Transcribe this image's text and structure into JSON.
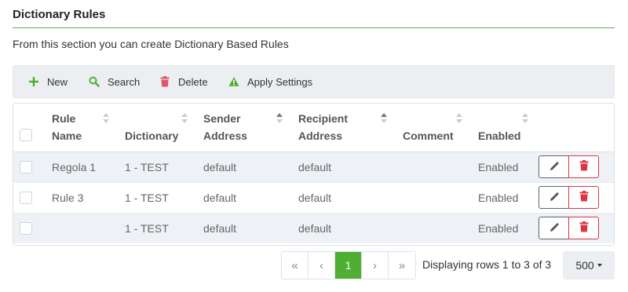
{
  "header": {
    "title": "Dictionary Rules",
    "description": "From this section you can create Dictionary Based Rules"
  },
  "toolbar": {
    "new_label": "New",
    "search_label": "Search",
    "delete_label": "Delete",
    "apply_label": "Apply Settings",
    "new_icon": "plus-icon",
    "search_icon": "search-icon",
    "delete_icon": "trash-icon",
    "apply_icon": "warning-icon",
    "new_color": "#4fae34",
    "search_color": "#4fae34",
    "delete_color": "#e0556a",
    "apply_color": "#4fae34"
  },
  "table": {
    "columns": {
      "rule_name_line1": "Rule",
      "rule_name_line2": "Name",
      "dictionary": "Dictionary",
      "sender_line1": "Sender",
      "sender_line2": "Address",
      "recipient_line1": "Recipient",
      "recipient_line2": "Address",
      "comment": "Comment",
      "enabled": "Enabled"
    },
    "sorted_column": "recipient",
    "rows": [
      {
        "rule_name": "Regola 1",
        "dictionary": "1 - TEST",
        "sender": "default",
        "recipient": "default",
        "comment": "",
        "enabled": "Enabled"
      },
      {
        "rule_name": "Rule 3",
        "dictionary": "1 - TEST",
        "sender": "default",
        "recipient": "default",
        "comment": "",
        "enabled": "Enabled"
      },
      {
        "rule_name": "",
        "dictionary": "1 - TEST",
        "sender": "default",
        "recipient": "default",
        "comment": "",
        "enabled": "Enabled"
      }
    ],
    "row_actions": {
      "edit_icon": "pencil-icon",
      "delete_icon": "trash-icon"
    }
  },
  "pagination": {
    "first": "«",
    "prev": "‹",
    "current_page": "1",
    "next": "›",
    "last": "»",
    "row_info": "Displaying rows 1 to 3 of 3",
    "page_size": "500"
  },
  "colors": {
    "accent": "#4fae34",
    "danger": "#dc3545",
    "toolbar_bg": "#eceef1",
    "row_stripe": "#eef1f6"
  }
}
